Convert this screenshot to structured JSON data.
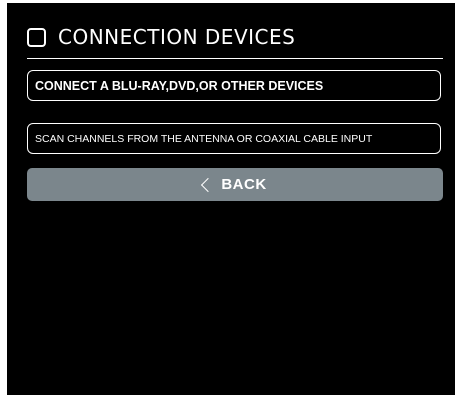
{
  "header": {
    "title": "CONNECTION DEVICES",
    "icon": "checkbox-square-icon"
  },
  "options": [
    {
      "label": "CONNECT A BLU-RAY,DVD,OR OTHER DEVICES",
      "highlighted": true
    },
    {
      "label": "SCAN CHANNELS FROM THE ANTENNA OR COAXIAL CABLE INPUT",
      "highlighted": false
    }
  ],
  "back_button": {
    "label": "BACK",
    "icon": "chevron-left-icon"
  },
  "colors": {
    "background": "#000000",
    "text": "#ffffff",
    "back_button": "#7b868c"
  }
}
